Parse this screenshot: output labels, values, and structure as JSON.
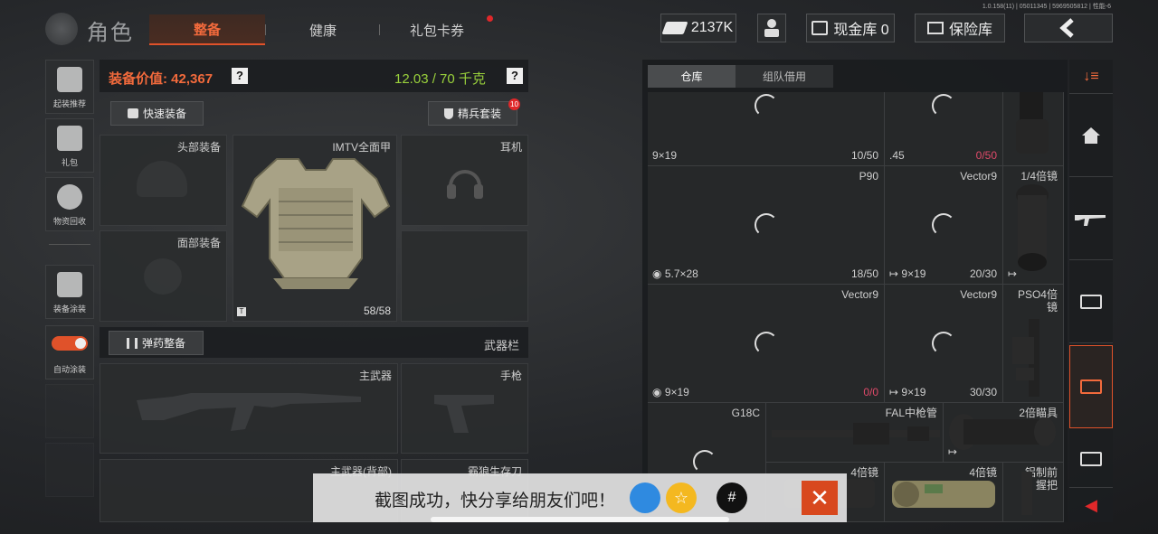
{
  "header": {
    "title": "角色",
    "tabs": [
      "整备",
      "健康",
      "礼包卡券"
    ],
    "version": "1.0.158(11) | 05011345 | 5969505812 | 性能-6",
    "cash": "2137K",
    "cash_store_label": "现金库 0",
    "safe_label": "保险库"
  },
  "left_sidebar": {
    "items": [
      "起装推荐",
      "礼包",
      "物资回收",
      "装备涂装",
      "自动涂装"
    ]
  },
  "equipment": {
    "value_label": "装备价值: 42,367",
    "weight_label": "12.03 / 70 千克",
    "help": "?",
    "quick_equip": "快速装备",
    "elite_set": "精兵套装",
    "elite_badge": "10",
    "slots": {
      "head": "头部装备",
      "armor_name": "IMTV全面甲",
      "armor_durability": "58/58",
      "armor_tag": "T",
      "earphone": "耳机",
      "face": "面部装备"
    },
    "ammo_label": "弹药整备",
    "weapon_bar": "武器栏",
    "primary": "主武器",
    "pistol": "手枪",
    "primary_back": "主武器(背部)",
    "survival_knife": "霸狼生存刀"
  },
  "warehouse": {
    "tabs": [
      "仓库",
      "组队借用"
    ],
    "items": [
      {
        "name": "",
        "ammo": "9×19",
        "count": "10/50",
        "count_red": false
      },
      {
        "name": "",
        "ammo": ".45",
        "count": "0/50",
        "count_red": true
      },
      {
        "name": "P90",
        "ammo": "5.7×28",
        "count": "18/50",
        "count_red": false
      },
      {
        "name": "Vector9",
        "ammo": "9×19",
        "count": "20/30",
        "count_red": false
      },
      {
        "name": "1/4倍镜",
        "ammo": "",
        "count": "",
        "count_red": false
      },
      {
        "name": "Vector9",
        "ammo": "9×19",
        "count": "0/0",
        "count_red": true
      },
      {
        "name": "Vector9",
        "ammo": "9×19",
        "count": "30/30",
        "count_red": false
      },
      {
        "name": "PSO4倍镜",
        "ammo": "",
        "count": "",
        "count_red": false
      },
      {
        "name": "G18C",
        "ammo": "",
        "count": "",
        "count_red": false
      },
      {
        "name": "FAL中枪管",
        "ammo": "",
        "count": "",
        "count_red": false
      },
      {
        "name": "2倍瞄具",
        "ammo": "",
        "count": "",
        "count_red": false
      },
      {
        "name": "4倍镜",
        "ammo": "",
        "count": "",
        "count_red": false
      },
      {
        "name": "4倍镜",
        "ammo": "",
        "count": "",
        "count_red": false
      },
      {
        "name": "铝制前握把",
        "ammo": "",
        "count": "",
        "count_red": false
      }
    ]
  },
  "toast": {
    "message": "截图成功，快分享给朋友们吧！"
  },
  "colors": {
    "accent": "#f26a3c",
    "value_orange": "#f26a3c",
    "weight_green": "#9ad23c",
    "red_count": "#e04a6a"
  }
}
